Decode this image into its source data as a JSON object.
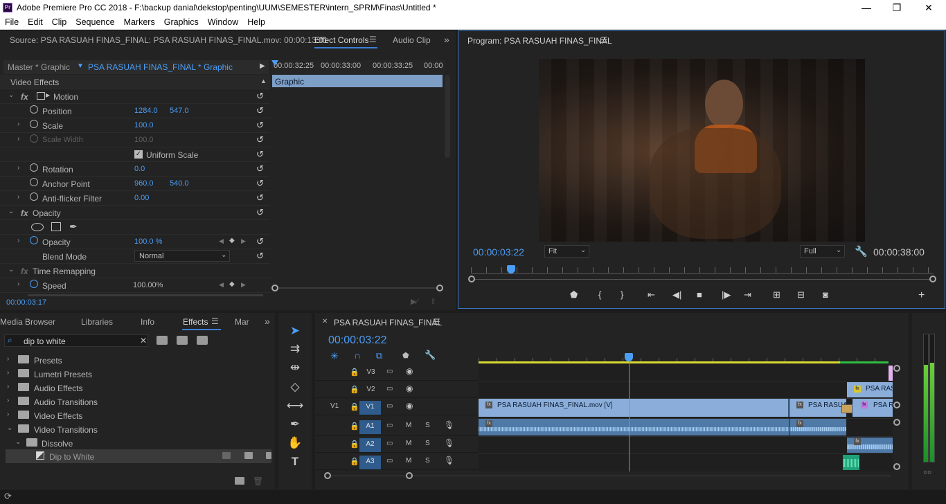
{
  "window": {
    "title": "Adobe Premiere Pro CC 2018 - F:\\backup danial\\dekstop\\penting\\UUM\\SEMESTER\\intern_SPRM\\Finas\\Untitled *",
    "logo": "Pr",
    "minimize": "—",
    "maximize": "❐",
    "close": "✕"
  },
  "menu": [
    "File",
    "Edit",
    "Clip",
    "Sequence",
    "Markers",
    "Graphics",
    "Window",
    "Help"
  ],
  "source_panel": {
    "title": "Source: PSA RASUAH FINAS_FINAL: PSA RASUAH FINAS_FINAL.mov: 00:00:13:01",
    "tab_effect_controls": "Effect Controls",
    "tab_audio": "Audio Clip",
    "more": "»"
  },
  "effect_controls": {
    "master": "Master * Graphic",
    "clip": "PSA RASUAH FINAS_FINAL * Graphic",
    "ruler": [
      "00:00:32:25",
      "00:00:33:00",
      "00:00:33:25",
      "00:00"
    ],
    "graphic_label": "Graphic",
    "video_effects": "Video Effects",
    "motion": "Motion",
    "position": {
      "label": "Position",
      "x": "1284.0",
      "y": "547.0"
    },
    "scale": {
      "label": "Scale",
      "v": "100.0"
    },
    "scale_width": {
      "label": "Scale Width",
      "v": "100.0"
    },
    "uniform_scale": "Uniform Scale",
    "rotation": {
      "label": "Rotation",
      "v": "0.0"
    },
    "anchor": {
      "label": "Anchor Point",
      "x": "960.0",
      "y": "540.0"
    },
    "antiflicker": {
      "label": "Anti-flicker Filter",
      "v": "0.00"
    },
    "opacity_group": "Opacity",
    "opacity": {
      "label": "Opacity",
      "v": "100.0 %"
    },
    "blend": {
      "label": "Blend Mode",
      "v": "Normal"
    },
    "time_remap": "Time Remapping",
    "speed": {
      "label": "Speed",
      "v": "100.00%"
    },
    "timecode": "00:00:03:17"
  },
  "program": {
    "title": "Program: PSA RASUAH FINAS_FINAL",
    "timecode": "00:00:03:22",
    "fit": "Fit",
    "quality": "Full",
    "duration": "00:00:38:00",
    "playhead_fraction": 0.087
  },
  "project_panel": {
    "tabs": [
      "Media Browser",
      "Libraries",
      "Info",
      "Effects",
      "Mar"
    ],
    "more": "»",
    "search": "dip to white",
    "tree": [
      {
        "label": "Presets",
        "lvl": 0,
        "type": "folder"
      },
      {
        "label": "Lumetri Presets",
        "lvl": 0,
        "type": "folder"
      },
      {
        "label": "Audio Effects",
        "lvl": 0,
        "type": "folder"
      },
      {
        "label": "Audio Transitions",
        "lvl": 0,
        "type": "folder"
      },
      {
        "label": "Video Effects",
        "lvl": 0,
        "type": "folder"
      },
      {
        "label": "Video Transitions",
        "lvl": 0,
        "type": "folder",
        "open": true
      },
      {
        "label": "Dissolve",
        "lvl": 1,
        "type": "folder",
        "open": true
      },
      {
        "label": "Dip to White",
        "lvl": 2,
        "type": "effect"
      }
    ]
  },
  "timeline": {
    "title": "PSA RASUAH FINAS_FINAL",
    "timecode": "00:00:03:22",
    "tracks": [
      {
        "name": "V3",
        "kind": "video"
      },
      {
        "name": "V2",
        "kind": "video"
      },
      {
        "name": "V1",
        "kind": "video",
        "src": "V1"
      },
      {
        "name": "A1",
        "kind": "audio"
      },
      {
        "name": "A2",
        "kind": "audio"
      },
      {
        "name": "A3",
        "kind": "audio"
      }
    ],
    "clips": {
      "v1_main": "PSA RASUAH FINAS_FINAL.mov [V]",
      "v1_second": "PSA RASUA",
      "v1_third": "PSA RA",
      "v2": "PSA RAS"
    },
    "audio_labels": {
      "m": "M",
      "s": "S"
    }
  },
  "colors": {
    "accent": "#4b9ef6",
    "clip_video": "#8aaed9",
    "clip_audio": "#4f7aa8",
    "graphic": "#e3b3f0",
    "yellow": "#d9d930",
    "green_audio": "#1fa07a"
  }
}
